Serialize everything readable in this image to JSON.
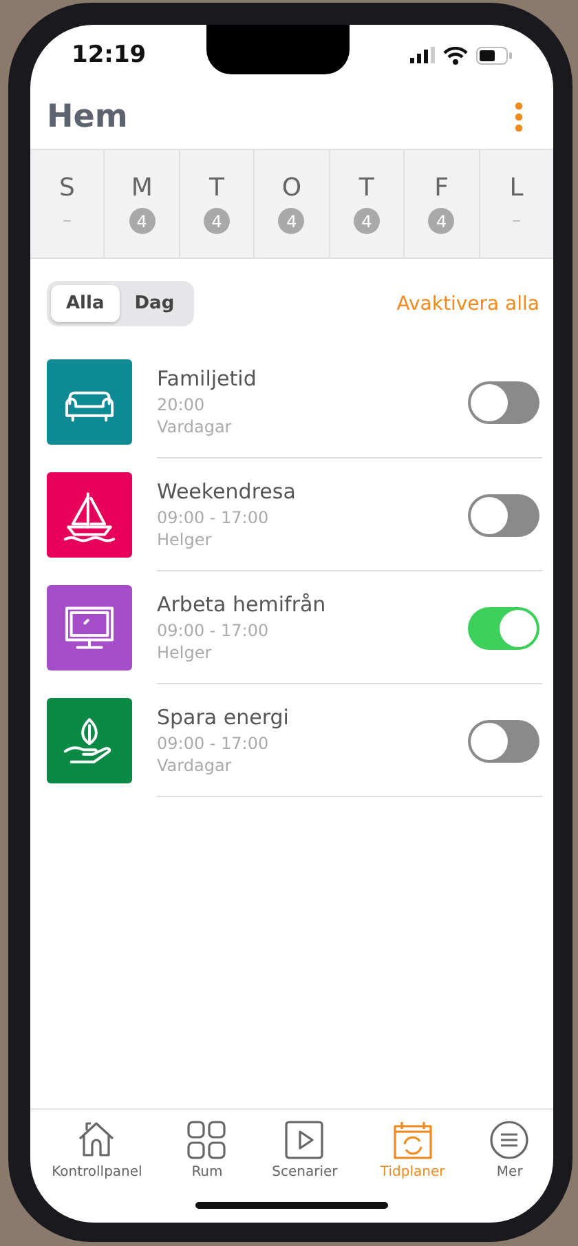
{
  "status_bar": {
    "time": "12:19"
  },
  "header": {
    "title": "Hem"
  },
  "days": [
    {
      "letter": "S",
      "count": "–"
    },
    {
      "letter": "M",
      "count": "4"
    },
    {
      "letter": "T",
      "count": "4"
    },
    {
      "letter": "O",
      "count": "4"
    },
    {
      "letter": "T",
      "count": "4"
    },
    {
      "letter": "F",
      "count": "4"
    },
    {
      "letter": "L",
      "count": "–"
    }
  ],
  "segments": [
    {
      "label": "Alla",
      "selected": true
    },
    {
      "label": "Dag",
      "selected": false
    }
  ],
  "deactivate_all": "Avaktivera alla",
  "schedules": [
    {
      "name": "Familjetid",
      "time": "20:00",
      "days": "Vardagar",
      "color": "#0e8a94",
      "on": false
    },
    {
      "name": "Weekendresa",
      "time": "09:00 - 17:00",
      "days": "Helger",
      "color": "#e6005a",
      "on": false
    },
    {
      "name": "Arbeta hemifrån",
      "time": "09:00 - 17:00",
      "days": "Helger",
      "color": "#a64dc9",
      "on": true
    },
    {
      "name": "Spara energi",
      "time": "09:00 - 17:00",
      "days": "Vardagar",
      "color": "#0a8a45",
      "on": false
    }
  ],
  "tab_bar": [
    {
      "label": "Kontrollpanel",
      "selected": false
    },
    {
      "label": "Rum",
      "selected": false
    },
    {
      "label": "Scenarier",
      "selected": false
    },
    {
      "label": "Tidplaner",
      "selected": true
    },
    {
      "label": "Mer",
      "selected": false
    }
  ]
}
